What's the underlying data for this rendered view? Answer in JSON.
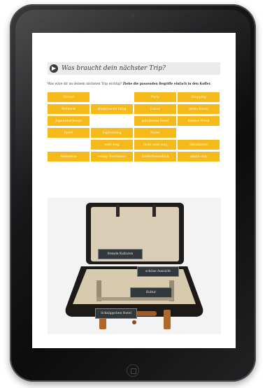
{
  "header": {
    "title": "Was braucht dein nächster Trip?",
    "intro_question": "Was wäre dir an deinem nächsten Trip wichtig?",
    "intro_instruction": "Ziehe die passenden Begriffe einfach in den Koffer."
  },
  "tiles": [
    {
      "label": "Strand"
    },
    {
      "label": ""
    },
    {
      "label": "Party"
    },
    {
      "label": "Shopping"
    },
    {
      "label": "Wellness"
    },
    {
      "label": "Hauptsache billig"
    },
    {
      "label": "Luxus"
    },
    {
      "label": "gutes Essen"
    },
    {
      "label": "Jugendherberge"
    },
    {
      "label": ""
    },
    {
      "label": "gehobenes Hotel"
    },
    {
      "label": "kleines Hotel"
    },
    {
      "label": "Sport"
    },
    {
      "label": "Sightseeing"
    },
    {
      "label": "Natur"
    },
    {
      "label": ""
    },
    {
      "label": ""
    },
    {
      "label": "weit weg"
    },
    {
      "label": "nicht weit weg"
    },
    {
      "label": "Ski/alpines"
    },
    {
      "label": "Animation"
    },
    {
      "label": "wenig Tourismus"
    },
    {
      "label": "kinderfreundlich"
    },
    {
      "label": "adults only"
    }
  ],
  "suitcase_items": [
    {
      "label": "fremde Kulturen"
    },
    {
      "label": "schöne Aussicht"
    },
    {
      "label": "Kultur"
    },
    {
      "label": "Schnäppchen Hotel"
    }
  ],
  "colors": {
    "tile": "#f5b91a",
    "header_bar": "#ebebeb",
    "chip": "#33383b"
  }
}
